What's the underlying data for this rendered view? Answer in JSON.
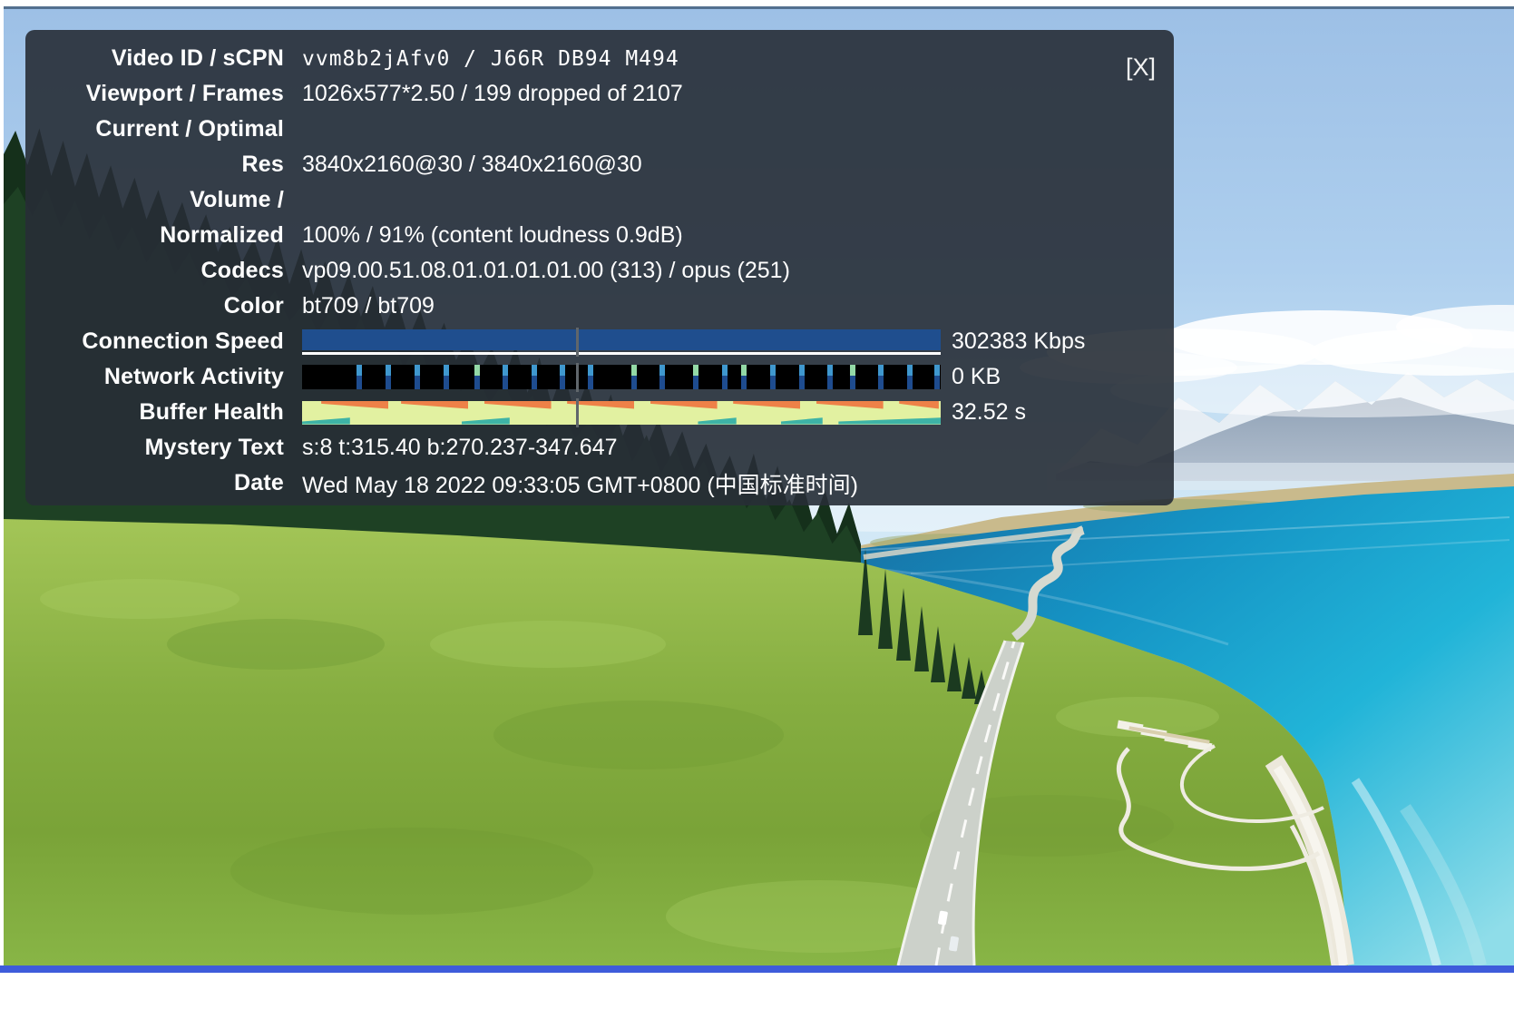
{
  "player": {
    "progress_color": "#3e5cdb",
    "topline_color": "#53708f",
    "panel_bg": "rgba(39,46,54,0.9)"
  },
  "stats_panel": {
    "close_button": "[X]",
    "rows": [
      {
        "label": "Video ID / sCPN",
        "value": "vvm8b2jAfv0 / J66R DB94 M494"
      },
      {
        "label": "Viewport / Frames",
        "value": "1026x577*2.50 / 199 dropped of 2107"
      },
      {
        "label": "Current / Optimal",
        "value": ""
      },
      {
        "label": "Res",
        "value": "3840x2160@30 / 3840x2160@30"
      },
      {
        "label": "Volume /",
        "value": ""
      },
      {
        "label": "Normalized",
        "value": "100% / 91% (content loudness 0.9dB)"
      },
      {
        "label": "Codecs",
        "value": "vp09.00.51.08.01.01.01.01.00 (313) / opus (251)"
      },
      {
        "label": "Color",
        "value": "bt709 / bt709"
      }
    ],
    "bars": {
      "connection_speed": {
        "label": "Connection Speed",
        "value": "302383 Kbps",
        "fill_color": "#1f4e8e",
        "underline_color": "#ffffff"
      },
      "network_activity": {
        "label": "Network Activity",
        "value": "0 KB",
        "bg_color": "#000000",
        "stripe_dark": "#1e4c8f",
        "stripe_light": "#3f98cf",
        "stripe_green": "#93d9a6",
        "stripes": [
          {
            "x": 0.085,
            "k": "b"
          },
          {
            "x": 0.131,
            "k": "b"
          },
          {
            "x": 0.176,
            "k": "b"
          },
          {
            "x": 0.222,
            "k": "b"
          },
          {
            "x": 0.27,
            "k": "g"
          },
          {
            "x": 0.314,
            "k": "b"
          },
          {
            "x": 0.359,
            "k": "b"
          },
          {
            "x": 0.404,
            "k": "b"
          },
          {
            "x": 0.448,
            "k": "b"
          },
          {
            "x": 0.515,
            "k": "g"
          },
          {
            "x": 0.56,
            "k": "b"
          },
          {
            "x": 0.612,
            "k": "g"
          },
          {
            "x": 0.658,
            "k": "b"
          },
          {
            "x": 0.688,
            "k": "g"
          },
          {
            "x": 0.733,
            "k": "b"
          },
          {
            "x": 0.778,
            "k": "b"
          },
          {
            "x": 0.822,
            "k": "b"
          },
          {
            "x": 0.858,
            "k": "g"
          },
          {
            "x": 0.902,
            "k": "b"
          },
          {
            "x": 0.947,
            "k": "b"
          },
          {
            "x": 0.99,
            "k": "b"
          }
        ]
      },
      "buffer_health": {
        "label": "Buffer Health",
        "value": "32.52 s",
        "fill_color": "#e2f1a1",
        "orange_color": "#ee8148",
        "teal_color": "#3eb3a6",
        "orange_segments": [
          {
            "x": 0.03,
            "w": 0.105
          },
          {
            "x": 0.155,
            "w": 0.105
          },
          {
            "x": 0.285,
            "w": 0.105
          },
          {
            "x": 0.415,
            "w": 0.105
          },
          {
            "x": 0.545,
            "w": 0.105
          },
          {
            "x": 0.675,
            "w": 0.105
          },
          {
            "x": 0.805,
            "w": 0.105
          },
          {
            "x": 0.935,
            "w": 0.062
          }
        ],
        "teal_segments": [
          {
            "x": 0.0,
            "w": 0.075
          },
          {
            "x": 0.25,
            "w": 0.075
          },
          {
            "x": 0.62,
            "w": 0.06
          },
          {
            "x": 0.75,
            "w": 0.065
          },
          {
            "x": 0.84,
            "w": 0.16
          }
        ]
      }
    },
    "playhead_fraction": 0.43,
    "playhead_color": "#60666b",
    "tail_rows": [
      {
        "label": "Mystery Text",
        "value": "s:8 t:315.40 b:270.237-347.647"
      },
      {
        "label": "Date",
        "value": "Wed May 18 2022 09:33:05 GMT+0800 (中国标准时间)"
      }
    ]
  }
}
